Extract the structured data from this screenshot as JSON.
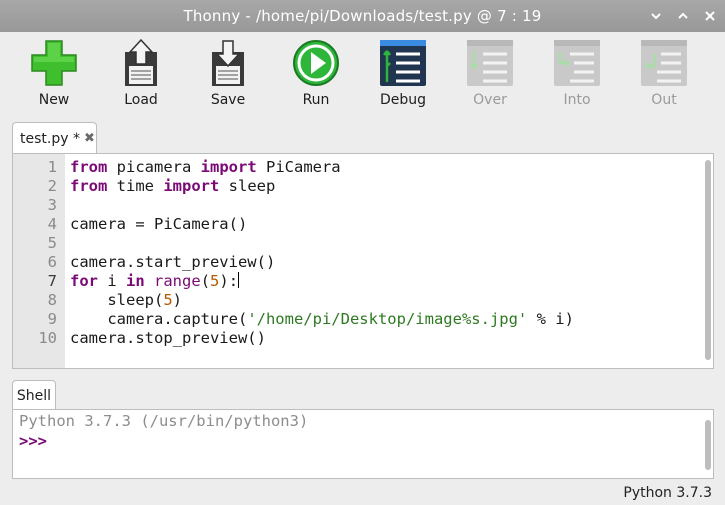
{
  "window": {
    "title": "Thonny  -  /home/pi/Downloads/test.py  @  7 : 19",
    "controls": [
      "chevron-down",
      "chevron-up",
      "close"
    ]
  },
  "toolbar": {
    "buttons": [
      {
        "label": "New",
        "icon": "new-file-icon",
        "enabled": true
      },
      {
        "label": "Load",
        "icon": "load-icon",
        "enabled": true
      },
      {
        "label": "Save",
        "icon": "save-icon",
        "enabled": true
      },
      {
        "label": "Run",
        "icon": "run-icon",
        "enabled": true
      },
      {
        "label": "Debug",
        "icon": "debug-icon",
        "enabled": true
      },
      {
        "label": "Over",
        "icon": "step-over-icon",
        "enabled": false
      },
      {
        "label": "Into",
        "icon": "step-into-icon",
        "enabled": false
      },
      {
        "label": "Out",
        "icon": "step-out-icon",
        "enabled": false
      }
    ]
  },
  "editor": {
    "tab": {
      "label": "test.py *",
      "close": "✖"
    },
    "line_numbers": [
      "1",
      "2",
      "3",
      "4",
      "5",
      "6",
      "7",
      "8",
      "9",
      "10"
    ],
    "lines": [
      "from picamera import PiCamera",
      "from time import sleep",
      "",
      "camera = PiCamera()",
      "",
      "camera.start_preview()",
      "for i in range(5):",
      "    sleep(5)",
      "    camera.capture('/home/pi/Desktop/image%s.jpg' % i)",
      "camera.stop_preview()"
    ],
    "tokens": {
      "kw_from": "from",
      "kw_import": "import",
      "kw_for": "for",
      "kw_in": "in",
      "mod_picamera": " picamera ",
      "cls_picamera": " PiCamera",
      "mod_time": " time ",
      "fn_sleep": " sleep",
      "l4": "camera = PiCamera()",
      "l6": "camera.start_preview()",
      "l7_i": " i ",
      "l7_range": "range",
      "l7_open": "(",
      "num5": "5",
      "l7_close": "):",
      "l8_a": "    sleep(",
      "l8_close": ")",
      "l9_a": "    camera.capture(",
      "l9_str": "'/home/pi/Desktop/image%s.jpg'",
      "l9_b": " % i)",
      "l10": "camera.stop_preview()"
    }
  },
  "shell": {
    "tab_label": "Shell",
    "info": "Python 3.7.3 (/usr/bin/python3)",
    "prompt": ">>>"
  },
  "status": {
    "interpreter": "Python 3.7.3"
  },
  "colors": {
    "keyword": "#7a0a75",
    "number": "#b35a00",
    "string": "#2f7a22",
    "titlebar": "#a0a0a0"
  }
}
